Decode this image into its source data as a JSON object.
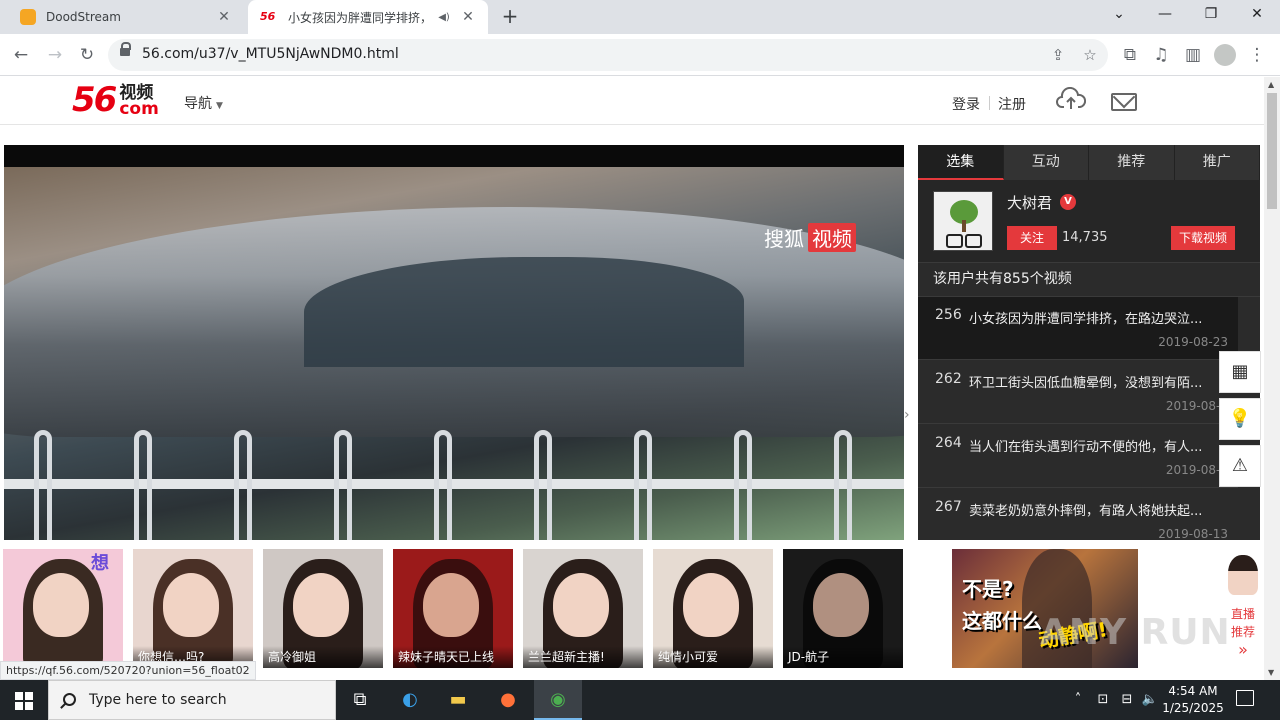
{
  "browser": {
    "tabs": [
      {
        "title": "DoodStream",
        "active": false
      },
      {
        "title": "小女孩因为胖遭同学排挤，",
        "active": true,
        "favicon": "56"
      }
    ],
    "url": "56.com/u37/v_MTU5NjAwNDM0.html",
    "status_url": "https://qf.56.com/520720?union=56_float02"
  },
  "site": {
    "logo_num": "56",
    "logo_cn_top": "视频",
    "logo_cn_bottom": "com",
    "nav_label": "导航",
    "login": "登录",
    "register": "注册"
  },
  "player": {
    "watermark_a": "搜狐",
    "watermark_b": "视频"
  },
  "side": {
    "tabs": [
      "选集",
      "互动",
      "推荐",
      "推广"
    ],
    "active_tab": "选集",
    "uploader_name": "大树君",
    "verified_mark": "V",
    "follow_label": "关注",
    "follow_count": "14,735",
    "download_label": "下载视频",
    "video_count_text": "该用户共有855个视频",
    "episodes": [
      {
        "num": "256",
        "title": "小女孩因为胖遭同学排挤，在路边哭泣...",
        "date": "2019-08-23",
        "active": true
      },
      {
        "num": "262",
        "title": "环卫工街头因低血糖晕倒，没想到有陌...",
        "date": "2019-08-2",
        "active": false
      },
      {
        "num": "264",
        "title": "当人们在街头遇到行动不便的他，有人...",
        "date": "2019-08-1",
        "active": false
      },
      {
        "num": "267",
        "title": "卖菜老奶奶意外摔倒，有路人将她扶起...",
        "date": "2019-08-13",
        "active": false
      }
    ]
  },
  "strip": {
    "thumbs": [
      {
        "caption": "",
        "bg": "#f4c9d8"
      },
      {
        "caption": "你想信…吗?",
        "bg": "#e8d6cf"
      },
      {
        "caption": "高冷御姐",
        "bg": "#cfc8c4"
      },
      {
        "caption": "辣妹子晴天已上线",
        "bg": "#9b1a1a"
      },
      {
        "caption": "兰兰超新主播!",
        "bg": "#d9d4d0"
      },
      {
        "caption": "纯情小可爱",
        "bg": "#e6dbd2"
      },
      {
        "caption": "JD-航子",
        "bg": "#1a1a1a"
      }
    ],
    "thumb1_overlay": "想",
    "ad_line1": "不是?",
    "ad_line2": "这都什么",
    "ad_line3": "动静啊!",
    "live_label_1": "直播",
    "live_label_2": "推荐",
    "live_arrow": "»"
  },
  "watermark": "ANY RUN",
  "taskbar": {
    "search_placeholder": "Type here to search",
    "time": "4:54 AM",
    "date": "1/25/2025"
  }
}
